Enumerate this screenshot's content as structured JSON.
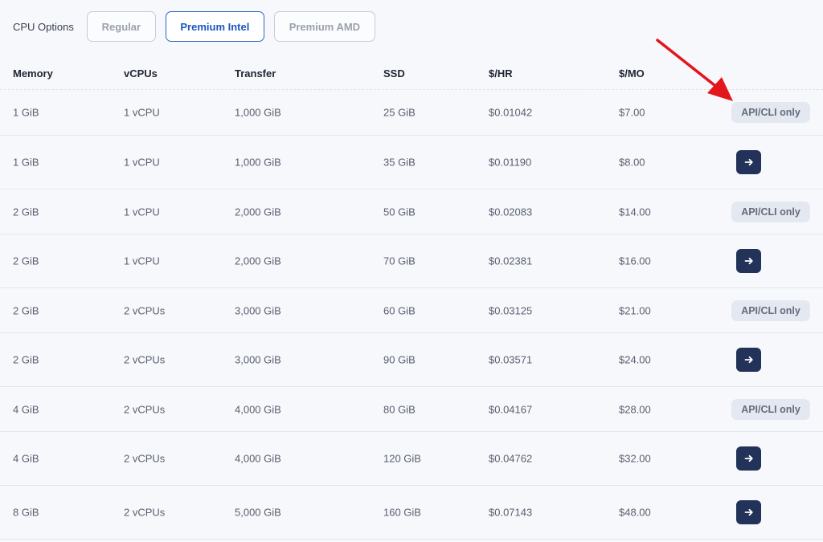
{
  "cpu_options": {
    "label": "CPU Options",
    "buttons": [
      {
        "label": "Regular",
        "selected": false
      },
      {
        "label": "Premium Intel",
        "selected": true
      },
      {
        "label": "Premium AMD",
        "selected": false
      }
    ]
  },
  "table": {
    "columns": [
      "Memory",
      "vCPUs",
      "Transfer",
      "SSD",
      "$/HR",
      "$/MO"
    ],
    "rows": [
      {
        "cells": [
          "1 GiB",
          "1 vCPU",
          "1,000 GiB",
          "25 GiB",
          "$0.01042",
          "$7.00"
        ],
        "action": "badge",
        "badge": "API/CLI only"
      },
      {
        "cells": [
          "1 GiB",
          "1 vCPU",
          "1,000 GiB",
          "35 GiB",
          "$0.01190",
          "$8.00"
        ],
        "action": "button",
        "icon": "arrow-right-icon"
      },
      {
        "cells": [
          "2 GiB",
          "1 vCPU",
          "2,000 GiB",
          "50 GiB",
          "$0.02083",
          "$14.00"
        ],
        "action": "badge",
        "badge": "API/CLI only"
      },
      {
        "cells": [
          "2 GiB",
          "1 vCPU",
          "2,000 GiB",
          "70 GiB",
          "$0.02381",
          "$16.00"
        ],
        "action": "button",
        "icon": "arrow-right-icon"
      },
      {
        "cells": [
          "2 GiB",
          "2 vCPUs",
          "3,000 GiB",
          "60 GiB",
          "$0.03125",
          "$21.00"
        ],
        "action": "badge",
        "badge": "API/CLI only"
      },
      {
        "cells": [
          "2 GiB",
          "2 vCPUs",
          "3,000 GiB",
          "90 GiB",
          "$0.03571",
          "$24.00"
        ],
        "action": "button",
        "icon": "arrow-right-icon"
      },
      {
        "cells": [
          "4 GiB",
          "2 vCPUs",
          "4,000 GiB",
          "80 GiB",
          "$0.04167",
          "$28.00"
        ],
        "action": "badge",
        "badge": "API/CLI only"
      },
      {
        "cells": [
          "4 GiB",
          "2 vCPUs",
          "4,000 GiB",
          "120 GiB",
          "$0.04762",
          "$32.00"
        ],
        "action": "button",
        "icon": "arrow-right-icon"
      },
      {
        "cells": [
          "8 GiB",
          "2 vCPUs",
          "5,000 GiB",
          "160 GiB",
          "$0.07143",
          "$48.00"
        ],
        "action": "button",
        "icon": "arrow-right-icon"
      }
    ]
  },
  "annotation": {
    "icon": "red-arrow-icon",
    "color": "#e3161b"
  },
  "colors": {
    "background": "#f6f8fb",
    "selected_accent": "#2f64c8",
    "action_button": "#233259",
    "badge_bg": "#e4e8f0"
  }
}
